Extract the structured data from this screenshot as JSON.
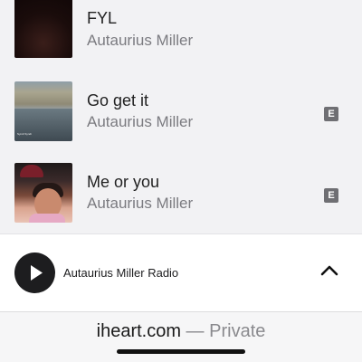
{
  "tracks": [
    {
      "title": "FYL",
      "artist": "Autaurius Miller",
      "explicit": false,
      "explicit_badge": ""
    },
    {
      "title": "Go get it",
      "artist": "Autaurius Miller",
      "explicit": true,
      "explicit_badge": "E",
      "art_caption": "Syndi Syndi"
    },
    {
      "title": "Me or you",
      "artist": "Autaurius Miller",
      "explicit": true,
      "explicit_badge": "E"
    }
  ],
  "player": {
    "station_name": "Autaurius Miller Radio",
    "play_icon": "play-icon",
    "expand_icon": "chevron-up-icon"
  },
  "browser": {
    "domain": "iheart.com",
    "separator": " — ",
    "mode": "Private"
  },
  "colors": {
    "background": "#f2f2f4",
    "explicit_badge": "#6f6f73",
    "play_button": "#1d1d1f",
    "artist_text": "#7b7b80"
  }
}
